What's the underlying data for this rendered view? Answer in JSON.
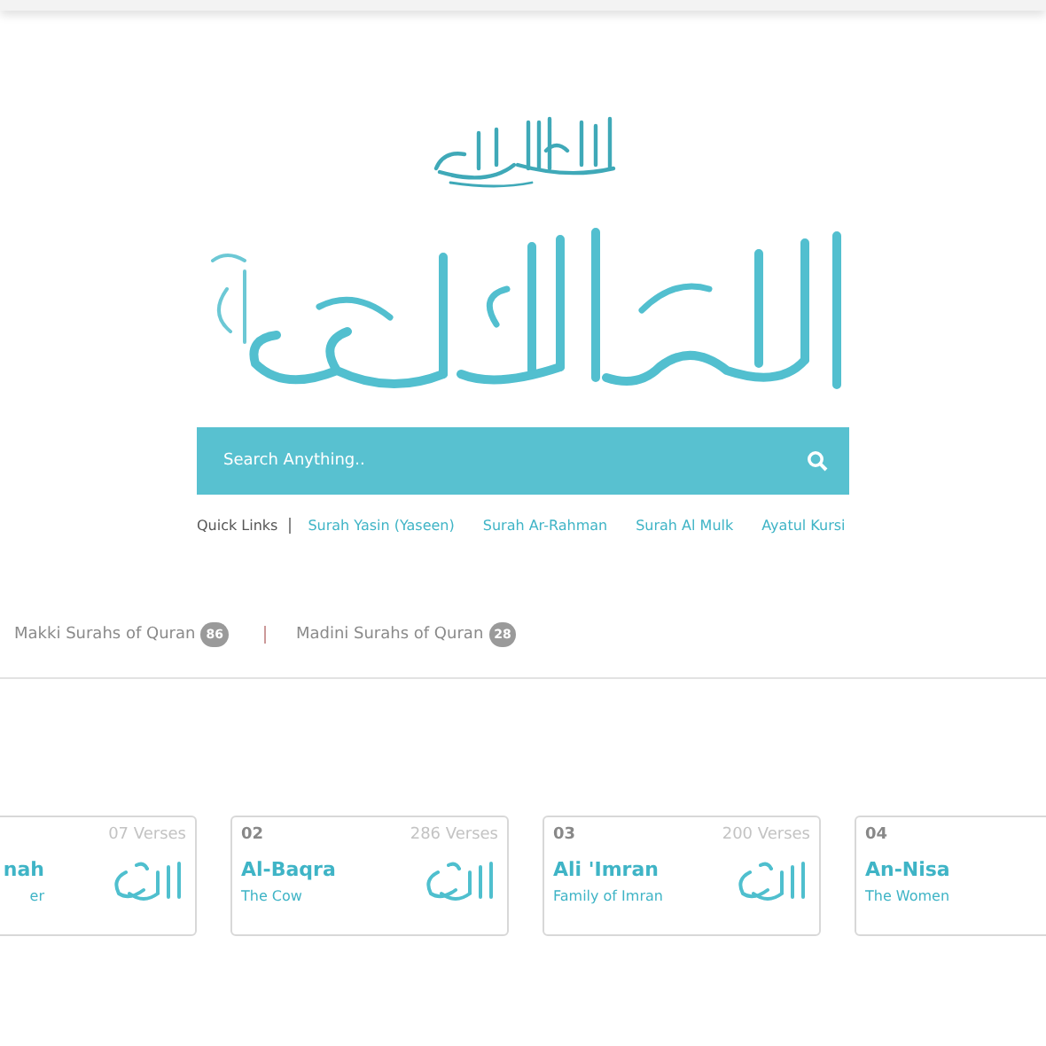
{
  "search": {
    "placeholder": "Search Anything.."
  },
  "quick_links": {
    "label": "Quick Links",
    "links": [
      "Surah Yasin (Yaseen)",
      "Surah Ar-Rahman",
      "Surah Al Mulk",
      "Ayatul Kursi"
    ]
  },
  "tabs": [
    {
      "label": "Makki Surahs of Quran",
      "count": "86"
    },
    {
      "label": "Madini Surahs of Quran",
      "count": "28"
    }
  ],
  "surahs": [
    {
      "verses": "07 Verses",
      "name": "nah",
      "meaning": "er",
      "calligraphy": true
    },
    {
      "number": "02",
      "verses": "286 Verses",
      "name": "Al-Baqra",
      "meaning": "The Cow",
      "calligraphy": true
    },
    {
      "number": "03",
      "verses": "200 Verses",
      "name": "Ali 'Imran",
      "meaning": "Family of Imran",
      "calligraphy": true
    },
    {
      "number": "04",
      "name": "An-Nisa",
      "meaning": "The Women",
      "calligraphy": false
    }
  ]
}
